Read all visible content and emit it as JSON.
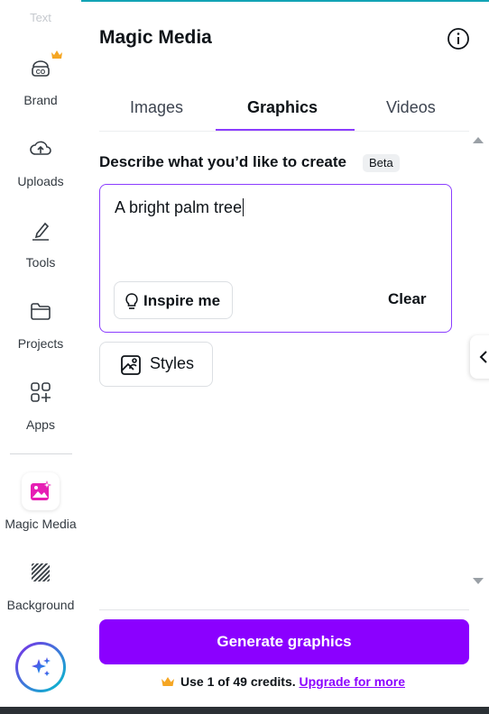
{
  "colors": {
    "accent": "#8b3dff",
    "generate_button": "#8b00ff",
    "crown": "#f5a623",
    "magic_media_icon": "#e61fb4"
  },
  "rail": {
    "faded_label": "Text",
    "items": [
      {
        "label": "Brand",
        "icon": "brand-kit-icon"
      },
      {
        "label": "Uploads",
        "icon": "cloud-upload-icon"
      },
      {
        "label": "Tools",
        "icon": "pen-tool-icon"
      },
      {
        "label": "Projects",
        "icon": "folder-icon"
      },
      {
        "label": "Apps",
        "icon": "apps-grid-icon"
      },
      {
        "label": "Magic Media",
        "icon": "magic-media-icon"
      },
      {
        "label": "Background",
        "icon": "background-pattern-icon"
      }
    ],
    "assistant_icon": "sparkle-icon"
  },
  "panel": {
    "title": "Magic Media",
    "info_icon": "info-icon",
    "tabs": [
      {
        "label": "Images",
        "active": false
      },
      {
        "label": "Graphics",
        "active": true
      },
      {
        "label": "Videos",
        "active": false
      }
    ],
    "describe_label": "Describe what you’d like to create",
    "beta_badge": "Beta",
    "prompt_value": "A bright palm tree",
    "inspire_label": "Inspire me",
    "clear_label": "Clear",
    "styles_label": "Styles",
    "generate_label": "Generate graphics",
    "credits_text": "Use 1 of 49 credits.",
    "upgrade_link": "Upgrade for more"
  }
}
